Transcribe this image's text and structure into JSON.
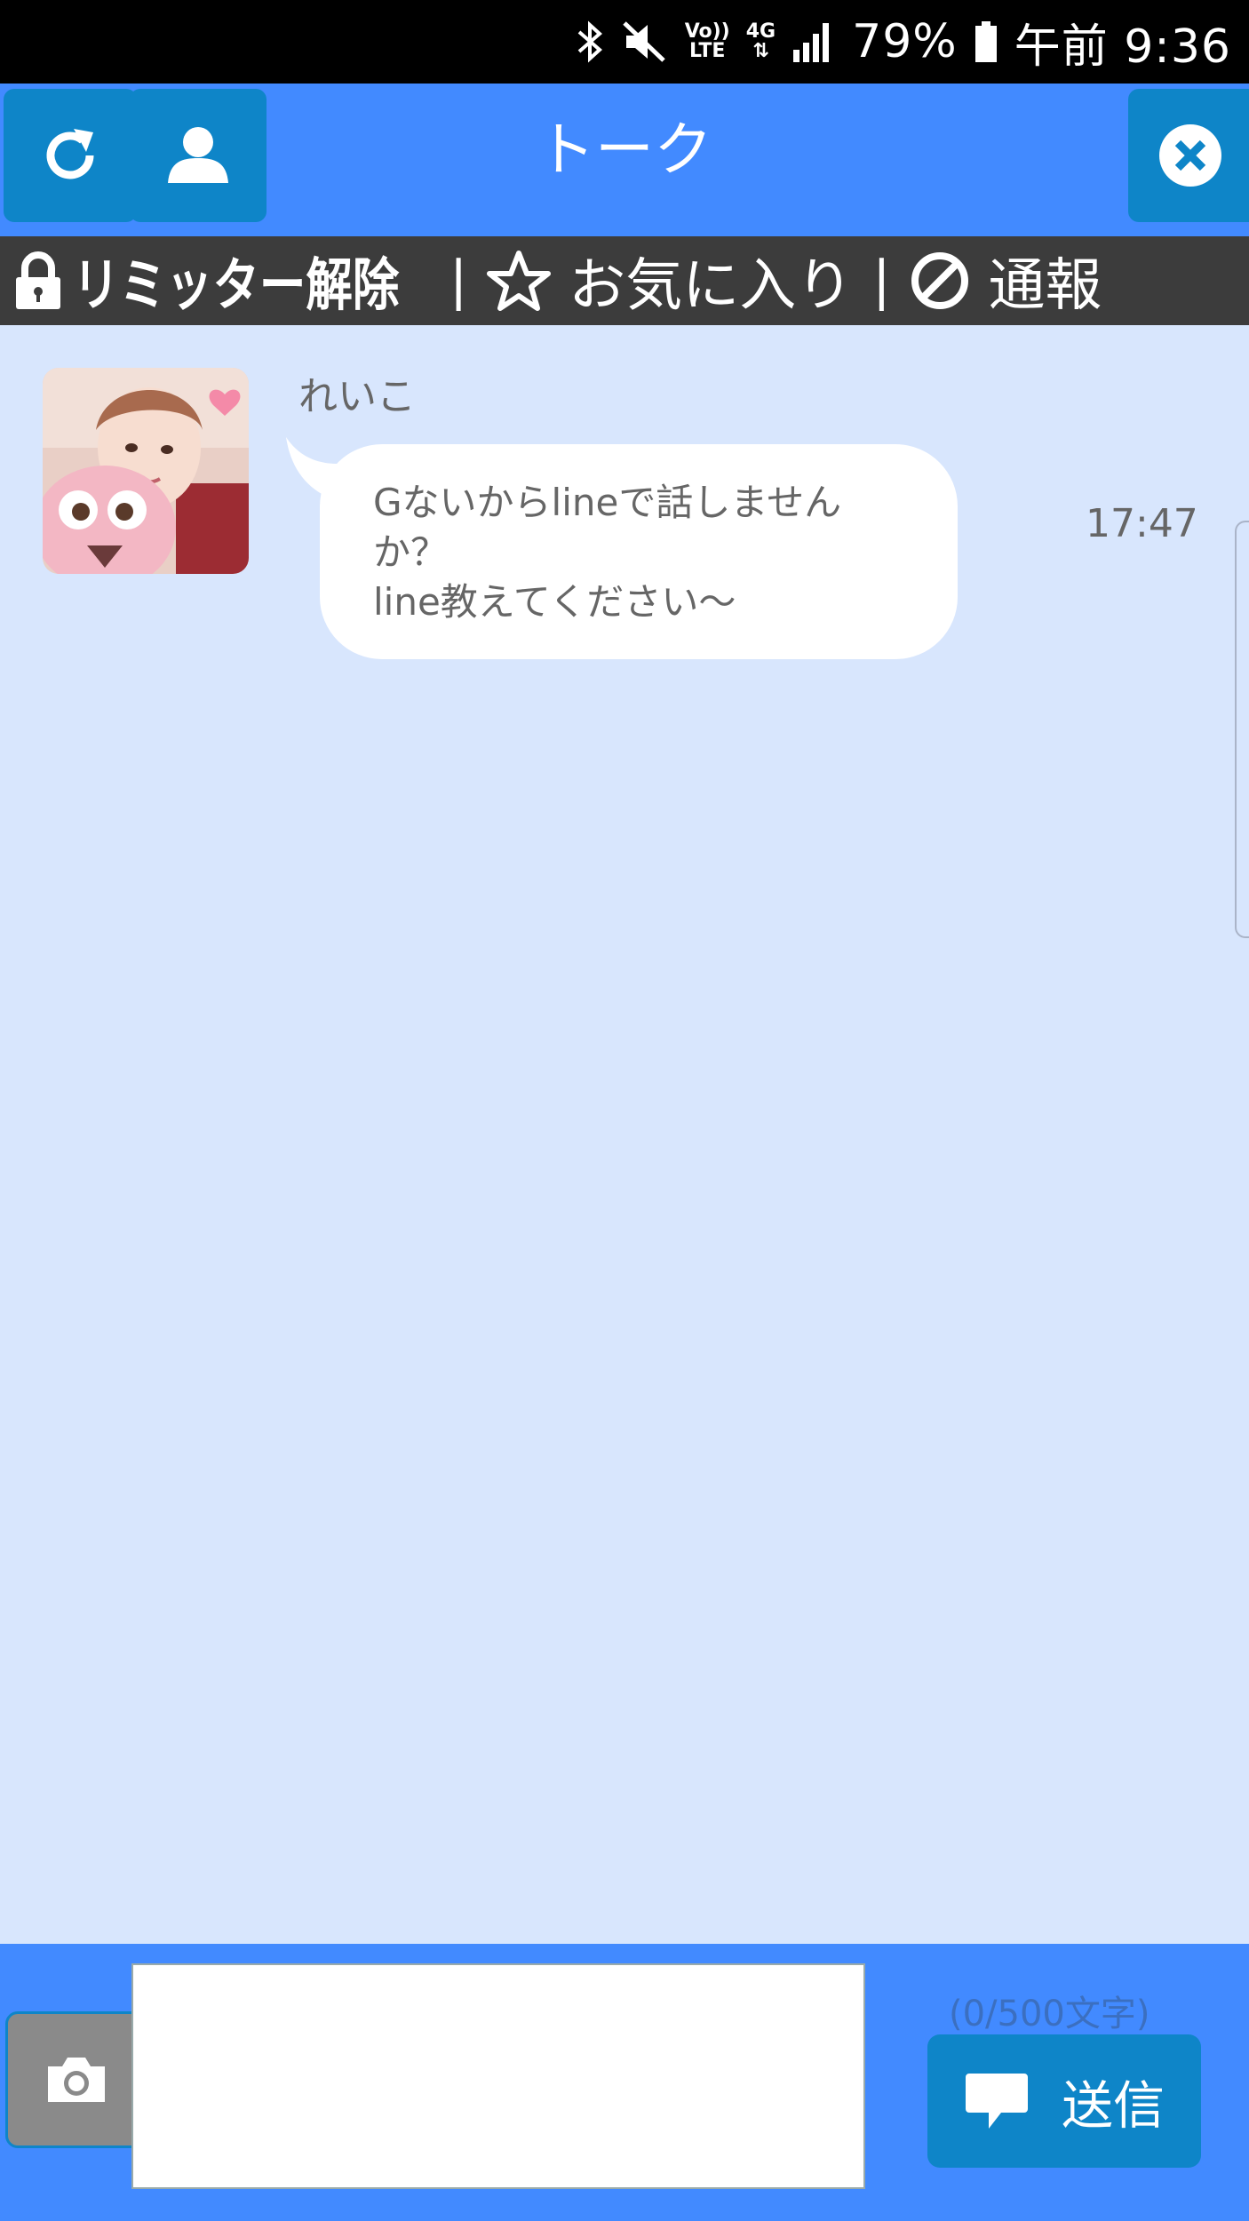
{
  "status_bar": {
    "volte_line1": "Vo))",
    "volte_line2": "LTE",
    "network": "4G",
    "battery": "79%",
    "time": "午前 9:36"
  },
  "header": {
    "title": "トーク"
  },
  "actions": {
    "limiter": "リミッター解除",
    "favorite": "お気に入り",
    "report": "通報",
    "separator": "|"
  },
  "message": {
    "sender": "れいこ",
    "lines": [
      "Gないからlineで話しません",
      "か？",
      "line教えてください〜"
    ],
    "time": "17:47"
  },
  "composer": {
    "value": "",
    "counter": "(0/500文字)",
    "send_label": "送信"
  },
  "colors": {
    "header_blue": "#428aff",
    "button_blue": "#0e85c8",
    "chat_bg": "#d8e6fd",
    "action_bar": "#3c3c3c"
  },
  "icons": [
    "bluetooth-icon",
    "mute-icon",
    "signal-icon",
    "battery-icon",
    "refresh-icon",
    "user-icon",
    "close-icon",
    "lock-icon",
    "star-icon",
    "block-icon",
    "camera-icon",
    "speech-bubble-icon"
  ]
}
